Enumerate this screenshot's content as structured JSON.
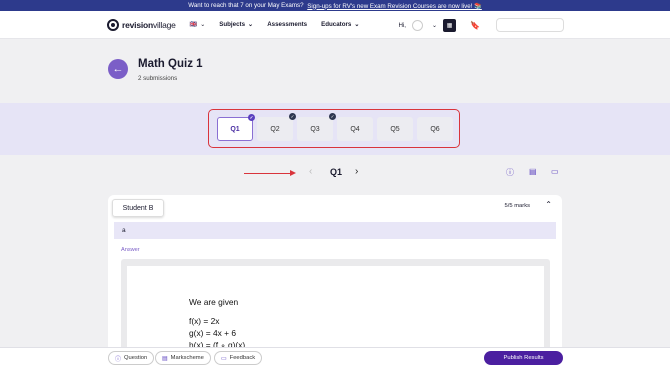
{
  "banner": {
    "text": "Want to reach that 7 on your May Exams?",
    "link": "Sign-ups for RV's new Exam Revision Courses are now live! 📚"
  },
  "nav": {
    "logo_bold": "revision",
    "logo_light": "village",
    "flag": "🇬🇧",
    "items": [
      {
        "label": "Subjects"
      },
      {
        "label": "Assessments"
      },
      {
        "label": "Educators"
      }
    ],
    "greeting": "Hi,"
  },
  "quiz": {
    "title": "Math Quiz 1",
    "submissions": "2 submissions"
  },
  "questions": [
    {
      "label": "Q1",
      "checked": true
    },
    {
      "label": "Q2",
      "checked": true
    },
    {
      "label": "Q3",
      "checked": true
    },
    {
      "label": "Q4",
      "checked": false
    },
    {
      "label": "Q5",
      "checked": false
    },
    {
      "label": "Q6",
      "checked": false
    }
  ],
  "pager": {
    "current": "Q1",
    "prev_icon": "chevron-left-icon",
    "next_icon": "chevron-right-icon"
  },
  "card": {
    "student": "Student B",
    "marks": "5/5 marks",
    "answer_text": "a",
    "answer_label": "Answer",
    "answer_lines": [
      "We are given",
      "f(x) = 2x",
      "g(x) = 4x + 6",
      "h(x) = (f ∘ g)(x)"
    ]
  },
  "footer": {
    "question": "Question",
    "markscheme": "Markscheme",
    "feedback": "Feedback",
    "publish": "Publish Results"
  },
  "colors": {
    "accent": "#7b5ec7",
    "publish": "#4b1fa0",
    "highlight": "#d9343c",
    "banner": "#2d3a8c"
  }
}
